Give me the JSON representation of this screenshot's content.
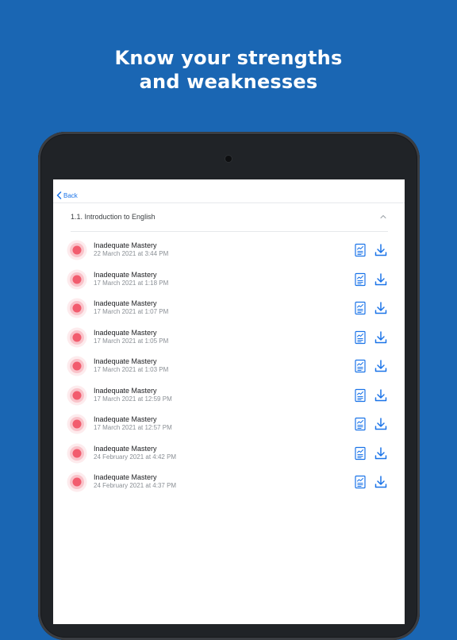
{
  "promo": {
    "line1": "Know your strengths",
    "line2": "and weaknesses"
  },
  "nav": {
    "back_label": "Back"
  },
  "section": {
    "title": "1.1. Introduction to English"
  },
  "colors": {
    "background": "#1a66b3",
    "accent": "#1a73e8",
    "mastery_badge": "#f25c6e"
  },
  "icons": {
    "back": "chevron-left-icon",
    "collapse": "chevron-up-icon",
    "status": "target-icon",
    "report": "report-document-icon",
    "download": "download-icon"
  },
  "results": [
    {
      "status": "Inadequate Mastery",
      "date": "22 March 2021 at 3:44 PM"
    },
    {
      "status": "Inadequate Mastery",
      "date": "17 March 2021 at 1:18 PM"
    },
    {
      "status": "Inadequate Mastery",
      "date": "17 March 2021 at 1:07 PM"
    },
    {
      "status": "Inadequate Mastery",
      "date": "17 March 2021 at 1:05 PM"
    },
    {
      "status": "Inadequate Mastery",
      "date": "17 March 2021 at 1:03 PM"
    },
    {
      "status": "Inadequate Mastery",
      "date": "17 March 2021 at 12:59 PM"
    },
    {
      "status": "Inadequate Mastery",
      "date": "17 March 2021 at 12:57 PM"
    },
    {
      "status": "Inadequate Mastery",
      "date": "24 February 2021 at 4:42 PM"
    },
    {
      "status": "Inadequate Mastery",
      "date": "24 February 2021 at 4:37 PM"
    }
  ]
}
